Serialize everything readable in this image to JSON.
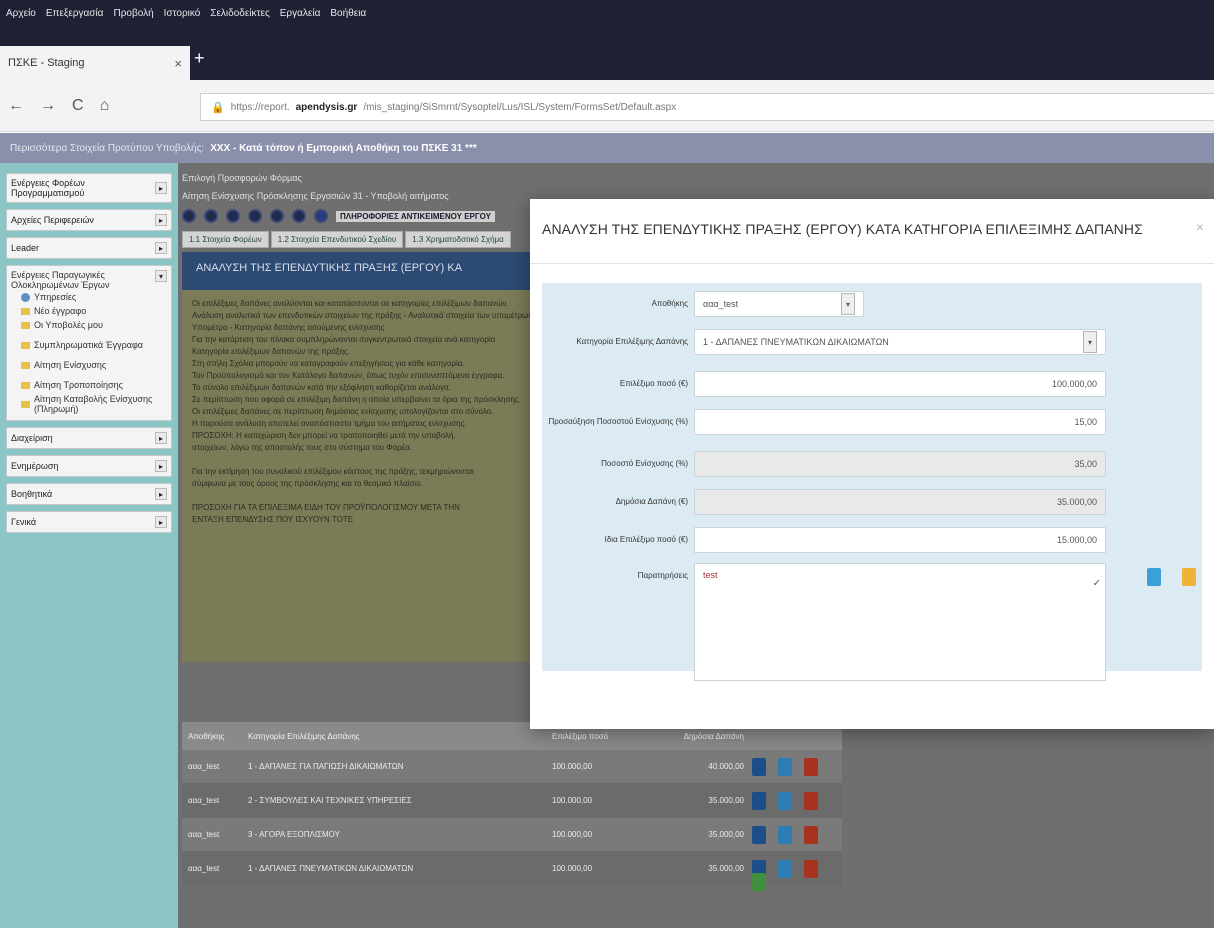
{
  "browser": {
    "menu": [
      "Αρχείο",
      "Επεξεργασία",
      "Προβολή",
      "Ιστορικό",
      "Σελιδοδείκτες",
      "Εργαλεία",
      "Βοήθεια"
    ],
    "tab_title": "ΠΣΚΕ - Staging",
    "tab_close": "×",
    "new_tab": "+",
    "nav": {
      "back": "←",
      "forward": "→",
      "reload": "C",
      "home": "⌂"
    },
    "url_prefix": "https://report.",
    "url_host": "apendysis.gr",
    "url_rest": "/mis_staging/SiSmrnt/Sysoptel/Lus/ISL/System/FormsSet/Default.aspx"
  },
  "app": {
    "header_label": "Περισσότερα Στοιχεία Προτύπου Υποβολής:",
    "header_project": "ΧΧΧ - Κατά τόπον ή Εμπορική Αποθήκη του ΠΣΚΕ 31 ***"
  },
  "sidebar": {
    "items": [
      {
        "label": "Ενέργειες Φορέων Προγραμματισμού"
      },
      {
        "label": "Αρχείες Περιφερειών"
      },
      {
        "label": "Leader"
      },
      {
        "label": "Ενέργειες Παραγωγικές Ολοκληρωμένων Έργων"
      }
    ],
    "subitems": [
      {
        "label": "Υπηρεσίες"
      },
      {
        "label": "Νέο έγγραφο"
      },
      {
        "label": "Οι Υποβολές μου"
      },
      {
        "label": "Συμπληρωματικά Έγγραφα"
      },
      {
        "label": "Αίτηση Ενίσχυσης"
      },
      {
        "label": "Αίτηση Τροποποίησης"
      },
      {
        "label": "Αίτηση Καταβολής Ενίσχυσης (Πληρωμή)"
      }
    ],
    "bottom_items": [
      {
        "label": "Διαχείριση"
      },
      {
        "label": "Ενημέρωση"
      },
      {
        "label": "Βοηθητικά"
      },
      {
        "label": "Γενικά"
      }
    ]
  },
  "main": {
    "crumb": "Επιλογή Προσφορών Φόρμας",
    "crumb2": "Αίτηση Ενίσχυσης Πρόσκλησης Εργασιών 31 - Υποβολή αιτήματος",
    "step_label": "ΠΛΗΡΟΦΟΡΙΕΣ ΑΝΤΙΚΕΙΜΕΝΟΥ ΕΡΓΟΥ",
    "subtabs": [
      "1.1 Στοιχεία Φορέων",
      "1.2 Στοιχεία Επενδυτικού Σχεδίου",
      "1.3 Χρηματοδοτικό Σχήμα"
    ],
    "banner": "ΑΝΑΛΥΣΗ ΤΗΣ ΕΠΕΝΔΥΤΙΚΗΣ ΠΡΑΞΗΣ (ΕΡΓΟΥ) ΚΑ",
    "text_lines": [
      "Οι επιλέξιμες δαπάνες αναλύονται και κατατάσσονται σε κατηγορίες επιλέξιμων δαπανών.",
      "Ανάλυση αναλυτικά των επενδυτικών στοιχείων της πράξης - Αναλυτικά στοιχεία των υπομέτρων",
      "Υπομέτρο - Κατηγορία δαπάνης αιτούμενης ενίσχυσης",
      "Για την κατάρτιση του πίνακα συμπληρώνονται συγκεντρωτικά στοιχεία ανά κατηγορία",
      "Κατηγορία επιλέξιμων δαπανών της πράξης.",
      "Στη στήλη Σχόλια μπορούν να καταγραφούν επεξηγήσεις για κάθε κατηγορία.",
      "Τον Προϋπολογισμό και τον Κατάλογο δαπανών, όπως τυχόν επισυναπτόμενα έγγραφα.",
      "Το σύνολο επιλέξιμων δαπανών κατά την εξόφληση καθορίζεται ανάλογα.",
      "Σε περίπτωση που αφορά σε επιλέξιμη δαπάνη η οποία υπερβαίνει τα όρια της πρόσκλησης.",
      "Οι επιλέξιμες δαπάνες σε περίπτωση δημόσιας ενίσχυσης υπολογίζονται στο σύνολο.",
      "Η παρούσα ανάλυση αποτελεί αναπόσπαστο τμήμα του αιτήματος ενίσχυσης.",
      "ΠΡΟΣΟΧΗ: Η καταχώριση δεν μπορεί να τροποποιηθεί μετά την υποβολή.",
      "στοιχείων, λόγω της αποστολής τους στο σύστημα του Φορέα.",
      "",
      "Για την εκτίμηση του συνολικού επιλέξιμου κόστους της πράξης, τεκμηριώνονται",
      "σύμφωνα με τους όρους της πρόσκλησης και το θεσμικό πλαίσιο.",
      "",
      "ΠΡΟΣΟΧΗ ΓΙΑ ΤΑ ΕΠΙΛΕΞΙΜΑ ΕΙΔΗ ΤΟΥ ΠΡΟΫΠΟΛΟΓΙΣΜΟΥ ΜΕΤΑ ΤΗΝ",
      "ΕΝΤΑΞΗ ΕΠΕΝΔΥΣΗΣ ΠΟΥ ΙΣΧΥΟΥΝ ΤΟΤΕ"
    ],
    "table": {
      "headers": [
        "Αποθήκης",
        "Κατηγορία Επιλέξιμης Δαπάνης",
        "Επιλέξιμο ποσό",
        "Δημόσια Δαπάνη"
      ],
      "rows": [
        {
          "code": "ααα_test",
          "category": "1 - ΔΑΠΑΝΕΣ ΓΙΑ ΠΑΓΙΩΣΗ ΔΙΚΑΙΩΜΑΤΩΝ",
          "amount": "100.000,00",
          "public": "40.000,00"
        },
        {
          "code": "ααα_test",
          "category": "2 - ΣΥΜΒΟΥΛΕΣ ΚΑΙ ΤΕΧΝΙΚΕΣ ΥΠΗΡΕΣΙΕΣ",
          "amount": "100.000,00",
          "public": "35.000,00"
        },
        {
          "code": "ααα_test",
          "category": "3 - ΑΓΟΡΑ ΕΞΟΠΛΙΣΜΟΥ",
          "amount": "100.000,00",
          "public": "35.000,00"
        },
        {
          "code": "ααα_test",
          "category": "1 - ΔΑΠΑΝΕΣ ΠΝΕΥΜΑΤΙΚΩΝ ΔΙΚΑΙΩΜΑΤΩΝ",
          "amount": "100.000,00",
          "public": "35.000,00"
        }
      ]
    }
  },
  "modal": {
    "title": "ΑΝΑΛΥΣΗ ΤΗΣ ΕΠΕΝΔΥΤΙΚΗΣ ΠΡΑΞΗΣ (ΕΡΓΟΥ) ΚΑΤΑ ΚΑΤΗΓΟΡΙΑ ΕΠΙΛΕΞΙΜΗΣ ΔΑΠΑΝΗΣ",
    "close": "×",
    "fields": {
      "warehouse": {
        "label": "Αποθήκης",
        "value": "ααα_test"
      },
      "category": {
        "label": "Κατηγορία Επιλέξιμης Δαπάνης",
        "value": "1 - ΔΑΠΑΝΕΣ ΠΝΕΥΜΑΤΙΚΩΝ ΔΙΚΑΙΩΜΑΤΩΝ"
      },
      "eligible_amount": {
        "label": "Επιλέξιμο ποσό (€)",
        "value": "100.000,00"
      },
      "surcharge": {
        "label": "Προσαύξηση Ποσοστού Ενίσχυσης (%)",
        "value": "15,00"
      },
      "aid_rate": {
        "label": "Ποσοστό Ενίσχυσης (%)",
        "value": "35,00"
      },
      "public_expense": {
        "label": "Δημόσια Δαπάνη (€)",
        "value": "35.000,00"
      },
      "own_amount": {
        "label": "Ιδια Επιλέξιμο ποσό (€)",
        "value": "15.000,00"
      },
      "comments": {
        "label": "Παρατηρήσεις",
        "value": "test"
      }
    },
    "select_arrow": "▾",
    "resize_mark": "✓"
  }
}
